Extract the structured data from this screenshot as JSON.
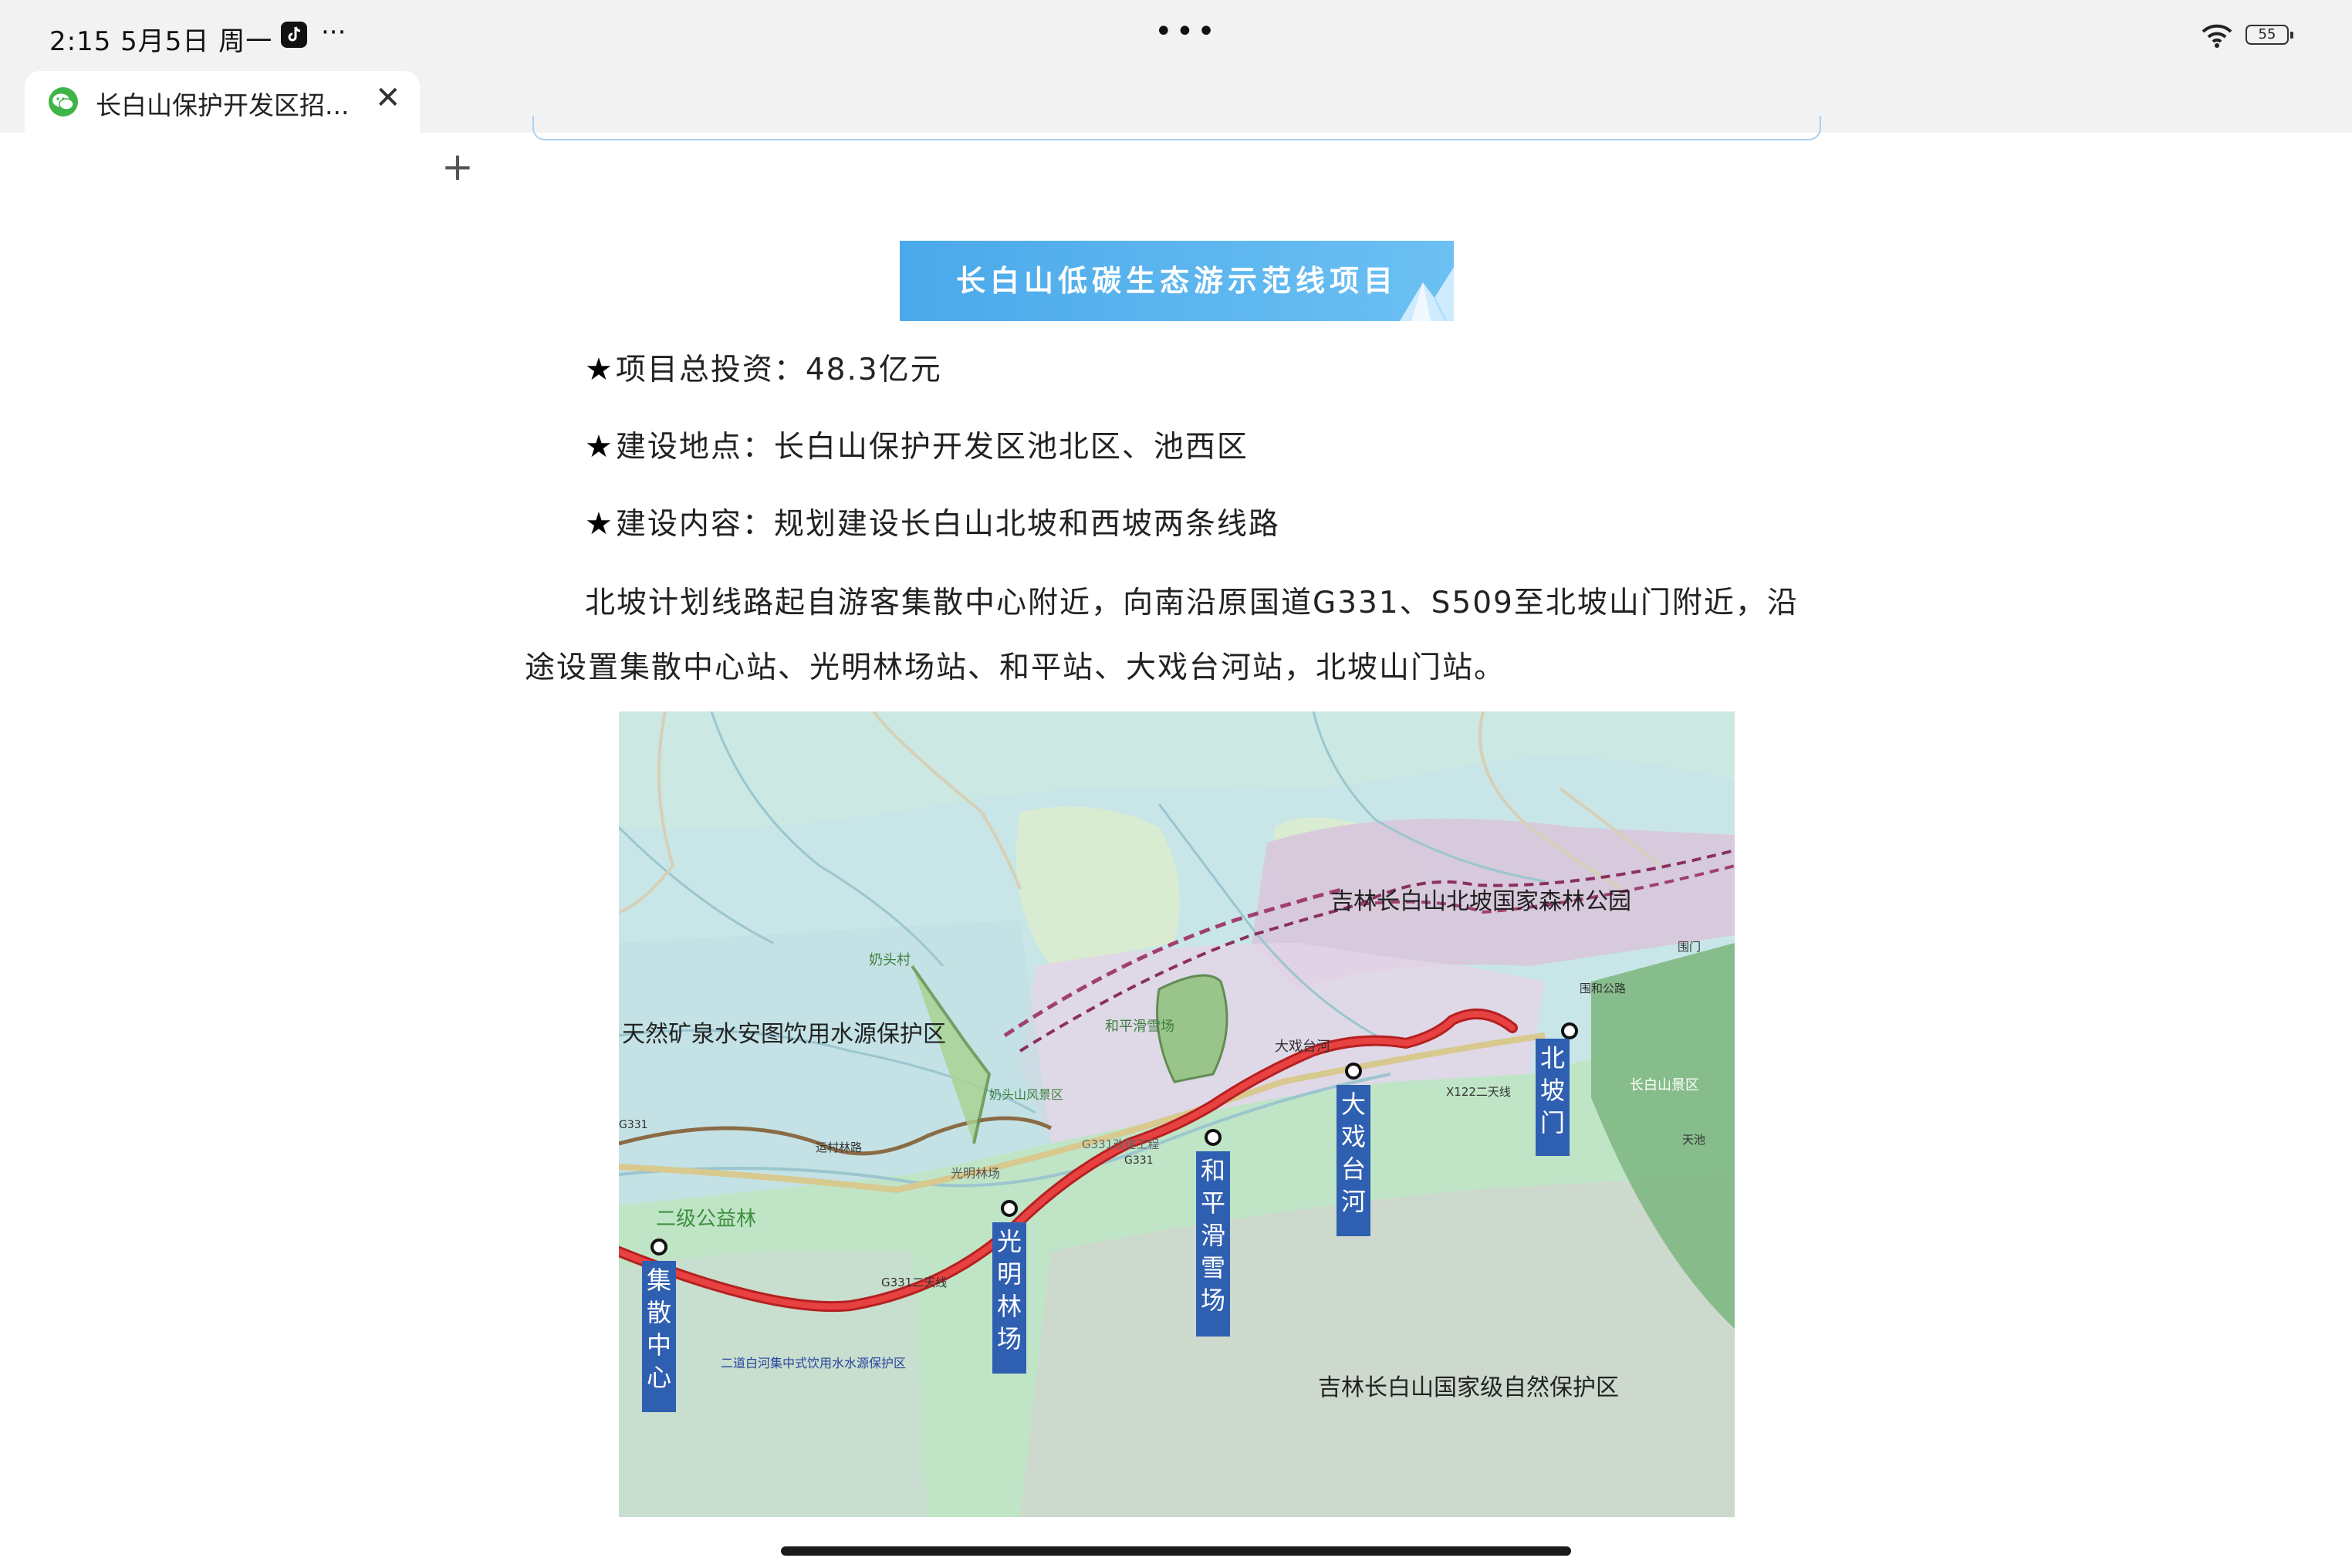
{
  "status_bar": {
    "time": "2:15",
    "date": "5月5日",
    "weekday": "周一",
    "more": "···",
    "center_dots": "•••",
    "battery": "55"
  },
  "tab": {
    "title": "长白山保护开发区招...",
    "close": "✕",
    "add": "+"
  },
  "banner": {
    "title": "长白山低碳生态游示范线项目"
  },
  "info": [
    {
      "star": "★",
      "text": "项目总投资：48.3亿元"
    },
    {
      "star": "★",
      "text": "建设地点：长白山保护开发区池北区、池西区"
    },
    {
      "star": "★",
      "text": "建设内容：规划建设长白山北坡和西坡两条线路"
    }
  ],
  "paragraph": "北坡计划线路起自游客集散中心附近，向南沿原国道G331、S509至北坡山门附近，沿途设置集散中心站、光明林场站、和平站、大戏台河站，北坡山门站。",
  "map": {
    "areas": [
      "吉林长白山北坡国家森林公园",
      "天然矿泉水安图饮用水源保护区",
      "吉林长白山国家级自然保护区",
      "二级公益林",
      "二道白河集中式饮用水水源保护区",
      "长白山景区"
    ],
    "places": [
      "奶头村",
      "和平滑雪场",
      "奶头山风景区",
      "光明林场",
      "大戏台河"
    ],
    "roads": [
      "G331",
      "运村林路",
      "G331改建工程",
      "G331二天线",
      "X122二天线",
      "围和公路",
      "围门",
      "天池"
    ],
    "stations": [
      "集散中心",
      "光明林场",
      "和平滑雪场",
      "大戏台河",
      "北坡门"
    ],
    "colors": {
      "route": "#d42424",
      "station_label_bg": "#2f5fb0",
      "reserve": "#8fc999",
      "park": "#d7c9dc"
    }
  }
}
